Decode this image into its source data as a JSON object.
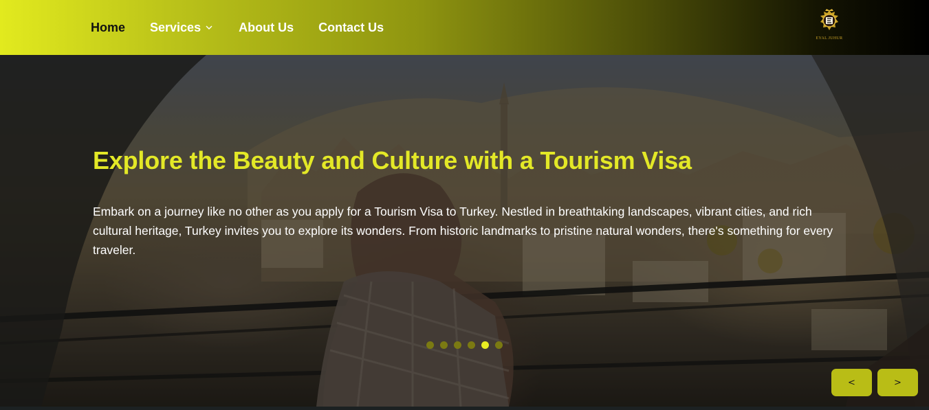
{
  "nav": {
    "links": [
      {
        "label": "Home"
      },
      {
        "label": "Services"
      },
      {
        "label": "About Us"
      },
      {
        "label": "Contact Us"
      }
    ],
    "logo_text": "EYAL JUHUR",
    "colors": {
      "accent": "#e3e827",
      "home_text": "#111111",
      "link_text": "#ffffff"
    }
  },
  "hero": {
    "title": "Explore the Beauty and Culture with a Tourism Visa",
    "description": "Embark on a journey like no other as you apply for a Tourism Visa to Turkey. Nestled in breathtaking landscapes, vibrant cities, and rich cultural heritage, Turkey invites you to explore its wonders. From historic landmarks to pristine natural wonders, there's something for every traveler.",
    "slides_count": 6,
    "active_slide": 5,
    "prev_label": "<",
    "next_label": ">"
  },
  "icons": [
    "chevron-down-icon",
    "crest-logo-icon"
  ]
}
